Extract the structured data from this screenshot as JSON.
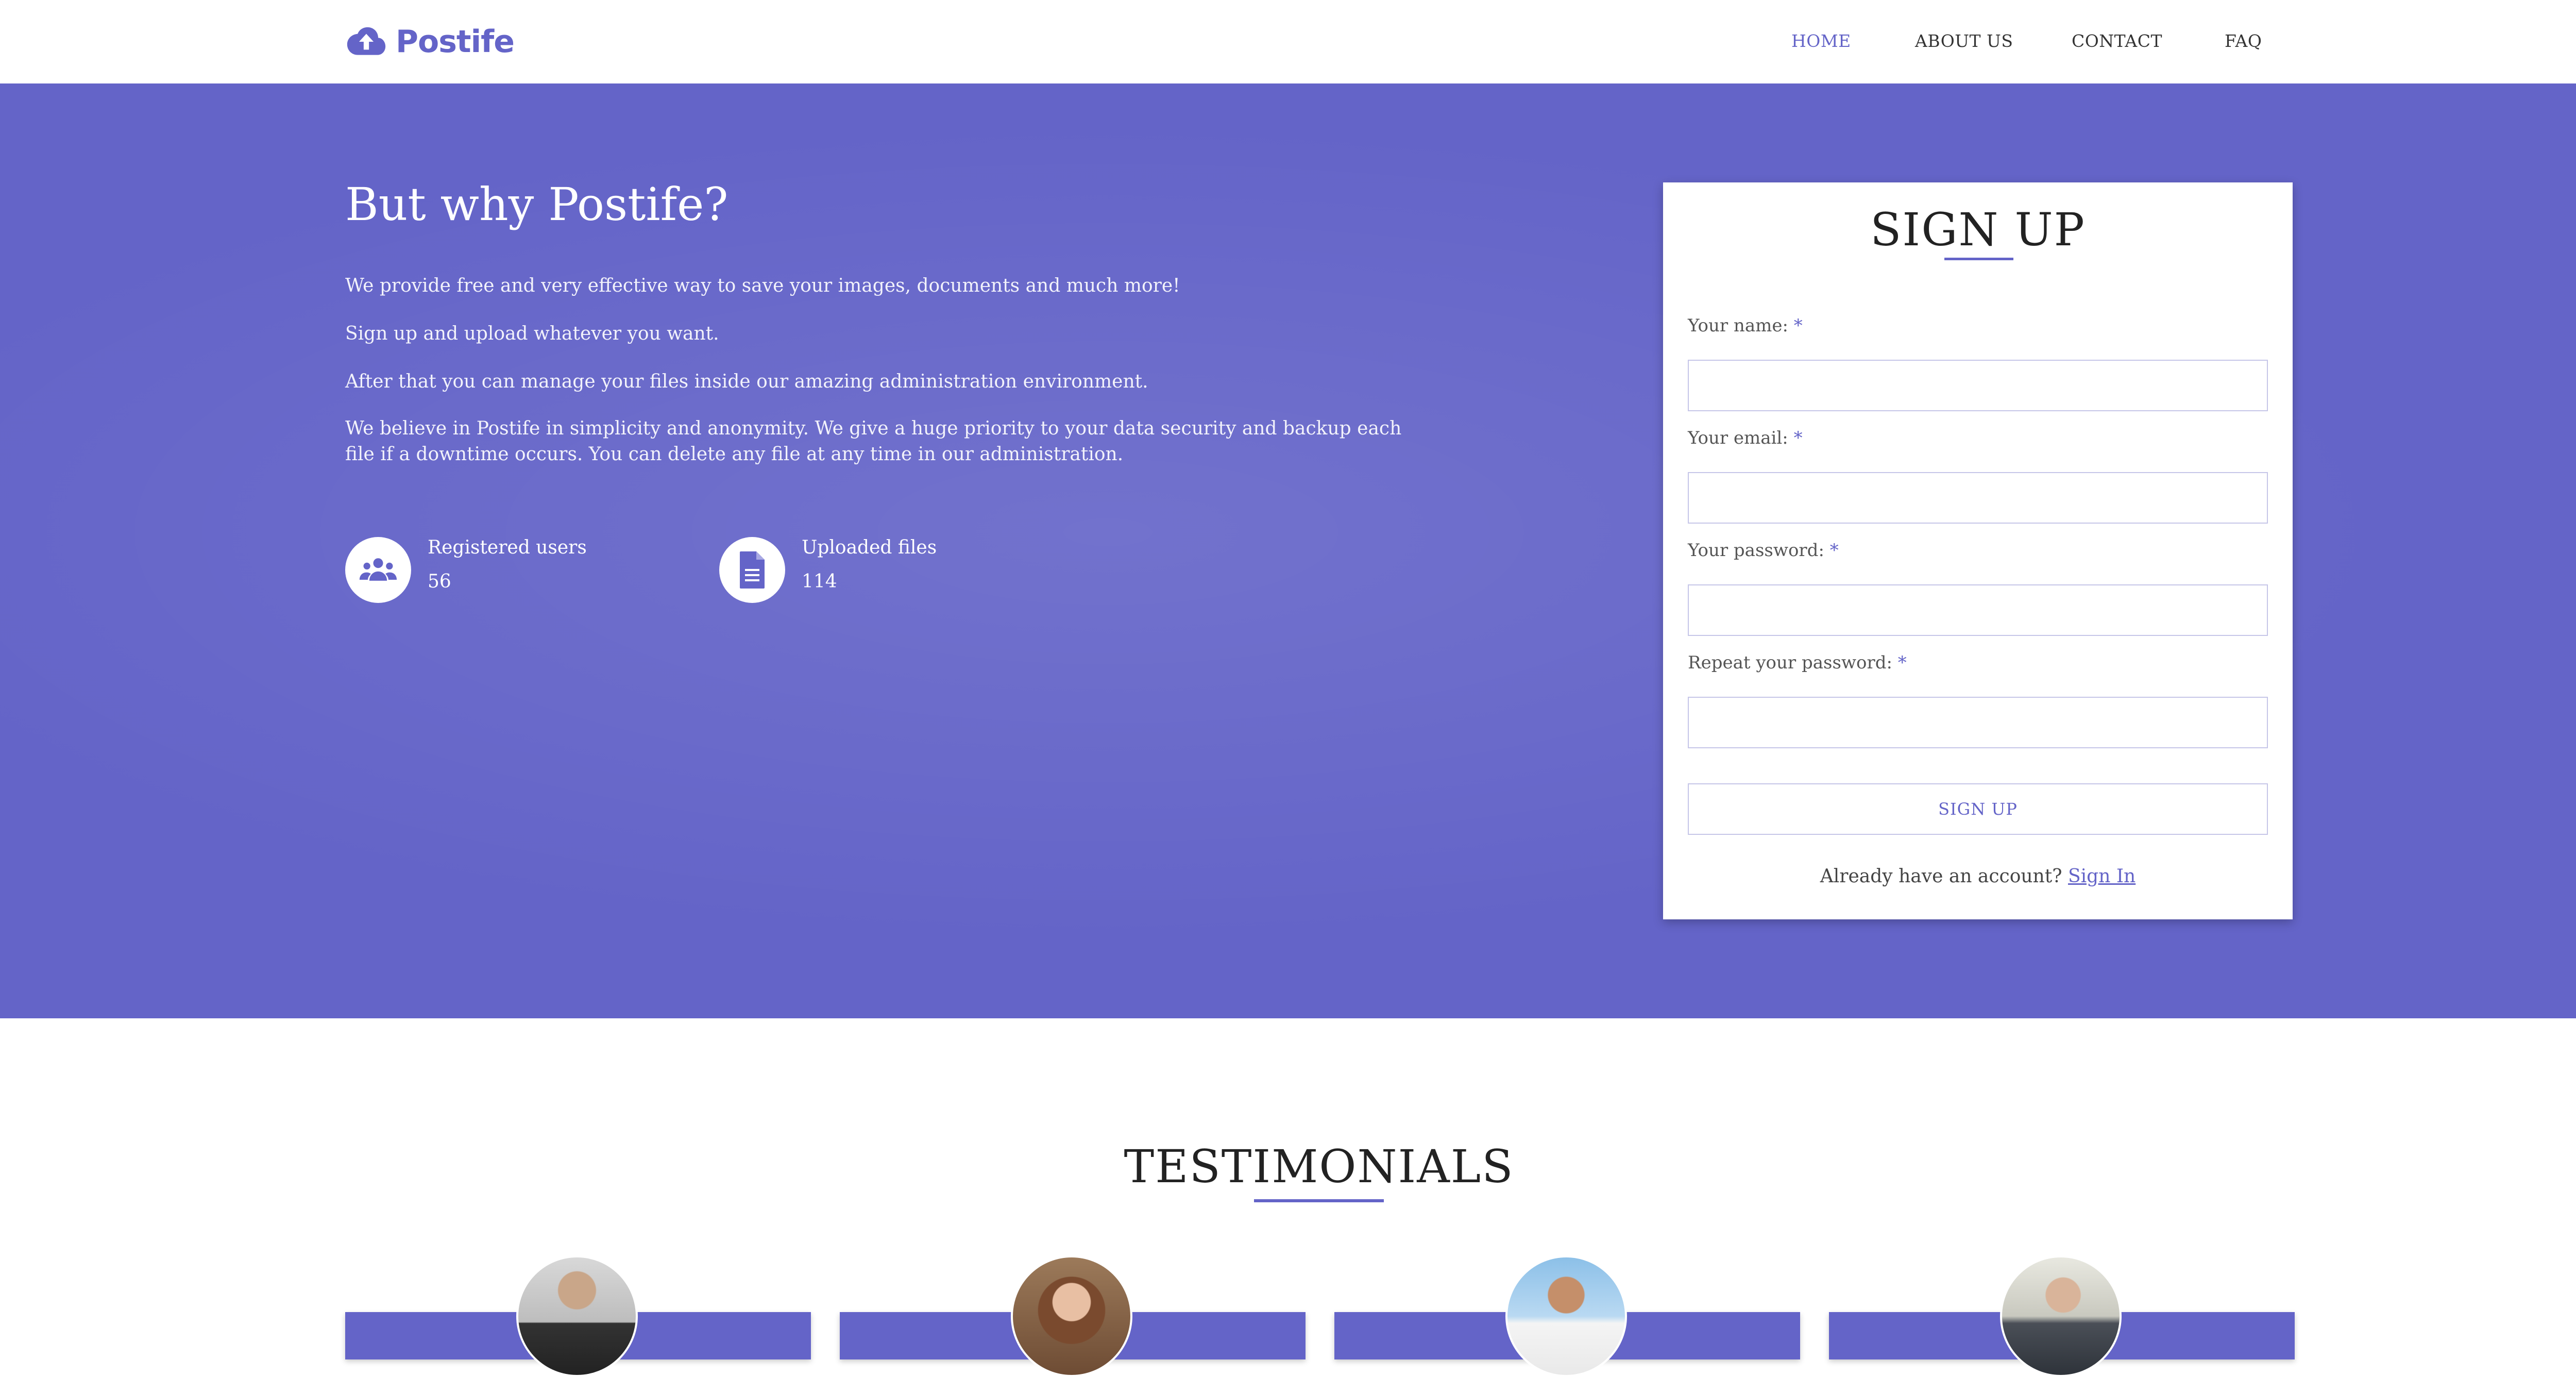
{
  "header": {
    "brand": "Postife",
    "nav": [
      {
        "label": "HOME",
        "active": true
      },
      {
        "label": "ABOUT US",
        "active": false
      },
      {
        "label": "CONTACT",
        "active": false
      },
      {
        "label": "FAQ",
        "active": false
      }
    ]
  },
  "hero": {
    "title": "But why Postife?",
    "paragraphs": [
      "We provide free and very effective way to save your images, documents and much more!",
      "Sign up and upload whatever you want.",
      "After that you can manage your files inside our amazing administration environment.",
      "We believe in Postife in simplicity and anonymity. We give a huge priority to your data security and backup each file if a downtime occurs. You can delete any file at any time in our administration."
    ],
    "stats": [
      {
        "label": "Registered users",
        "value": "56",
        "icon": "users-icon"
      },
      {
        "label": "Uploaded files",
        "value": "114",
        "icon": "file-icon"
      }
    ]
  },
  "signup": {
    "title": "SIGN UP",
    "fields": [
      {
        "label": "Your name:",
        "required_mark": "*",
        "value": ""
      },
      {
        "label": "Your email:",
        "required_mark": "*",
        "value": ""
      },
      {
        "label": "Your password:",
        "required_mark": "*",
        "value": ""
      },
      {
        "label": "Repeat your password:",
        "required_mark": "*",
        "value": ""
      }
    ],
    "button_label": "SIGN UP",
    "already_text": "Already have an account?",
    "signin_link": "Sign In"
  },
  "testimonials": {
    "title": "TESTIMONIALS"
  },
  "colors": {
    "accent": "#6464c8",
    "white": "#ffffff",
    "text": "#333333"
  }
}
